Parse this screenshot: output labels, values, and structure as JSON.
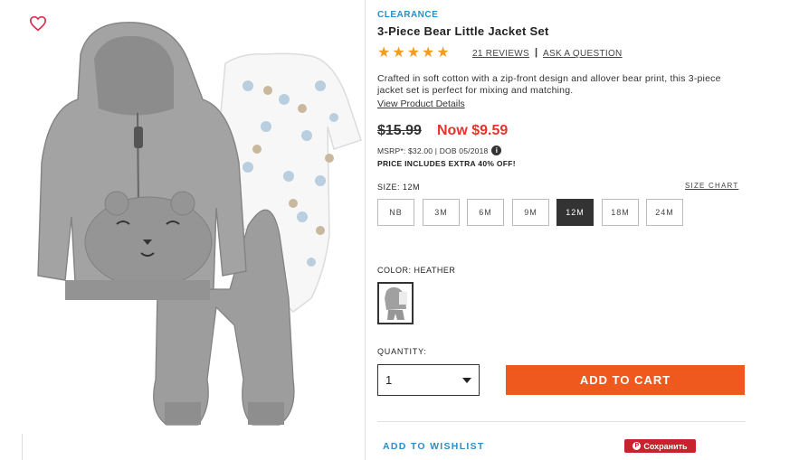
{
  "product": {
    "badge": "CLEARANCE",
    "title": "3-Piece Bear Little Jacket Set",
    "rating": 5,
    "reviews_label": "21 REVIEWS",
    "separator": "|",
    "ask_label": "ASK A QUESTION",
    "description": "Crafted in soft cotton with a zip-front design and allover bear print, this 3-piece jacket set is perfect for mixing and matching.",
    "details_link": "View Product Details"
  },
  "price": {
    "original": "$15.99",
    "now": "Now $9.59",
    "msrp": "MSRP*: $32.00 | DOB 05/2018",
    "note": "PRICE INCLUDES EXTRA 40% OFF!",
    "now_color": "#e7332c"
  },
  "size": {
    "label": "SIZE: 12M",
    "chart_link": "SIZE CHART",
    "options": [
      "NB",
      "3M",
      "6M",
      "9M",
      "12M",
      "18M",
      "24M"
    ],
    "selected": "12M"
  },
  "color": {
    "label": "COLOR: HEATHER"
  },
  "quantity": {
    "label": "QUANTITY:",
    "value": "1"
  },
  "actions": {
    "add_to_cart": "ADD TO CART",
    "wishlist": "ADD TO WISHLIST",
    "pin": "Сохранить",
    "accent": "#f0591d",
    "link_color": "#2a8fc9"
  },
  "icons": {
    "favorite": "heart-outline-icon",
    "info": "info-icon",
    "dropdown": "chevron-down-icon",
    "pinterest": "pinterest-icon"
  }
}
